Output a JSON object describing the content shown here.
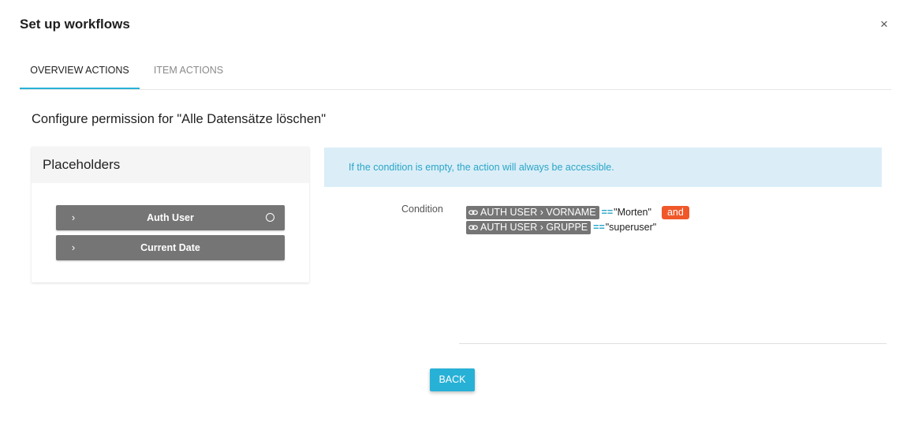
{
  "dialog": {
    "title": "Set up workflows",
    "close_symbol": "×"
  },
  "tabs": [
    {
      "label": "Overview Actions",
      "active": true
    },
    {
      "label": "Item Actions",
      "active": false
    }
  ],
  "section": {
    "heading": "Configure permission for \"Alle Datensätze löschen\""
  },
  "placeholders": {
    "title": "Placeholders",
    "items": [
      {
        "label": "Auth User",
        "chevron": "›",
        "has_radio": true
      },
      {
        "label": "Current Date",
        "chevron": "›",
        "has_radio": false
      }
    ]
  },
  "info": {
    "text": "If the condition is empty, the action will always be accessible."
  },
  "condition": {
    "label": "Condition",
    "rows": [
      {
        "variable": "AUTH USER › VORNAME",
        "operator": "==",
        "value": "\"Morten\"",
        "connector": "and"
      },
      {
        "variable": "AUTH USER › GRUPPE",
        "operator": "==",
        "value": "\"superuser\""
      }
    ]
  },
  "actions": {
    "back_label": "Back"
  },
  "icons": {
    "close": "close-icon",
    "chevron": "chevron-right-icon",
    "radio": "radio-circle-icon",
    "link": "link-icon"
  },
  "colors": {
    "accent": "#27b1d6",
    "chip": "#757575",
    "and_chip": "#f0582a",
    "info_bg": "#dbeef8",
    "info_text": "#2aa5c7"
  }
}
